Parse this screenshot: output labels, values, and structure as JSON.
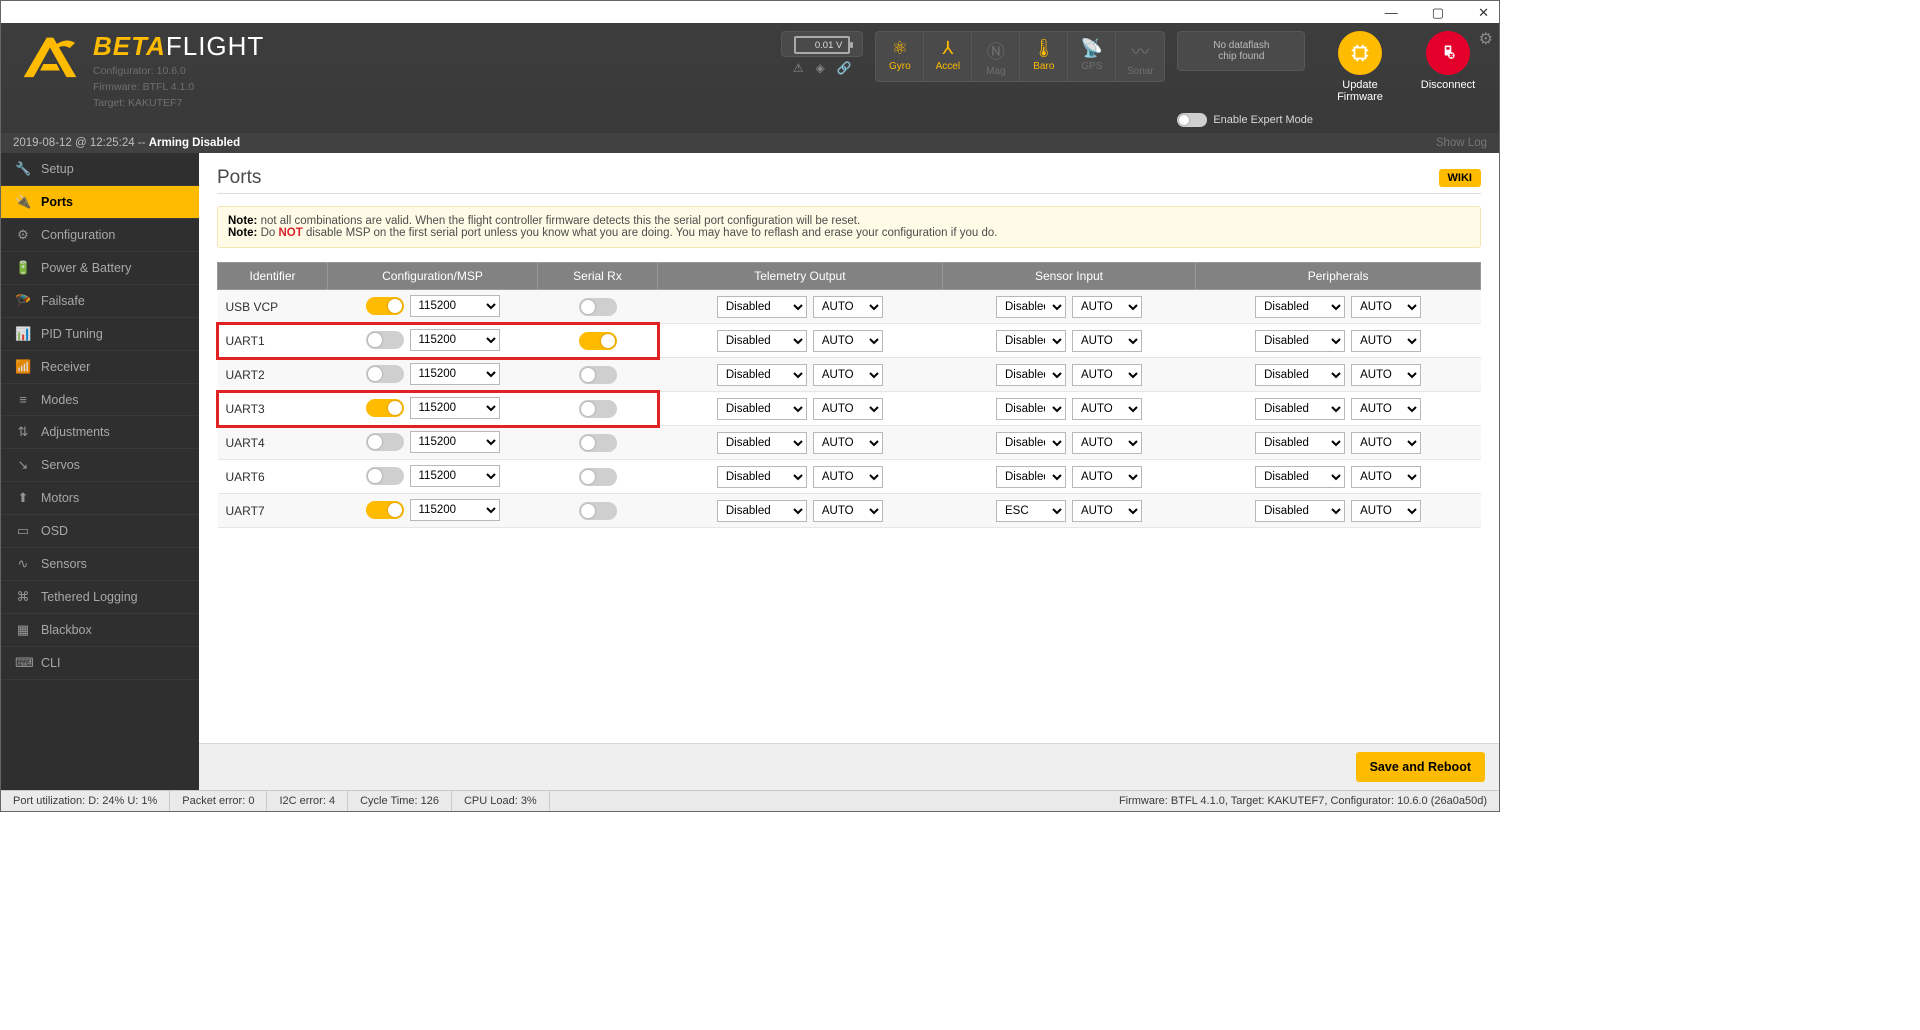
{
  "window": {
    "min": "—",
    "max": "▢",
    "close": "✕"
  },
  "header": {
    "brand_beta": "BETA",
    "brand_flight": "FLIGHT",
    "meta1": "Configurator: 10.6.0",
    "meta2": "Firmware: BTFL 4.1.0",
    "meta3": "Target: KAKUTEF7",
    "battery_v": "0.01 V",
    "sensors": [
      {
        "label": "Gyro",
        "active": true,
        "icon": "⚛"
      },
      {
        "label": "Accel",
        "active": true,
        "icon": "⅄"
      },
      {
        "label": "Mag",
        "active": false,
        "icon": "Ⓝ"
      },
      {
        "label": "Baro",
        "active": true,
        "icon": "🌡"
      },
      {
        "label": "GPS",
        "active": false,
        "icon": "📡"
      },
      {
        "label": "Sonar",
        "active": false,
        "icon": "〰"
      }
    ],
    "dataflash_l1": "No dataflash",
    "dataflash_l2": "chip found",
    "expert_label": "Enable Expert Mode",
    "update_label": "Update\nFirmware",
    "disconnect_label": "Disconnect"
  },
  "status": {
    "left": "2019-08-12 @ 12:25:24 -- ",
    "left_bold": "Arming Disabled",
    "show_log": "Show Log"
  },
  "sidebar": [
    {
      "icon": "🔧",
      "label": "Setup"
    },
    {
      "icon": "🔌",
      "label": "Ports"
    },
    {
      "icon": "⚙",
      "label": "Configuration"
    },
    {
      "icon": "🔋",
      "label": "Power & Battery"
    },
    {
      "icon": "🪂",
      "label": "Failsafe"
    },
    {
      "icon": "📊",
      "label": "PID Tuning"
    },
    {
      "icon": "📶",
      "label": "Receiver"
    },
    {
      "icon": "≡",
      "label": "Modes"
    },
    {
      "icon": "⇅",
      "label": "Adjustments"
    },
    {
      "icon": "↘",
      "label": "Servos"
    },
    {
      "icon": "⬆",
      "label": "Motors"
    },
    {
      "icon": "▭",
      "label": "OSD"
    },
    {
      "icon": "∿",
      "label": "Sensors"
    },
    {
      "icon": "⌘",
      "label": "Tethered Logging"
    },
    {
      "icon": "▦",
      "label": "Blackbox"
    },
    {
      "icon": "⌨",
      "label": "CLI"
    }
  ],
  "sidebar_active_index": 1,
  "page": {
    "title": "Ports",
    "wiki": "WIKI",
    "note_label": "Note:",
    "note1": " not all combinations are valid. When the flight controller firmware detects this the serial port configuration will be reset.",
    "note2a": " Do ",
    "note2_not": "NOT",
    "note2b": " disable MSP on the first serial port unless you know what you are doing. You may have to reflash and erase your configuration if you do.",
    "columns": [
      "Identifier",
      "Configuration/MSP",
      "Serial Rx",
      "Telemetry Output",
      "Sensor Input",
      "Peripherals"
    ],
    "rows": [
      {
        "id": "USB VCP",
        "msp_on": true,
        "msp_baud": "115200",
        "srx_on": false,
        "tel": "Disabled",
        "tel_b": "AUTO",
        "sen": "Disabled",
        "sen_b": "AUTO",
        "per": "Disabled",
        "per_b": "AUTO",
        "hl": false
      },
      {
        "id": "UART1",
        "msp_on": false,
        "msp_baud": "115200",
        "srx_on": true,
        "tel": "Disabled",
        "tel_b": "AUTO",
        "sen": "Disabled",
        "sen_b": "AUTO",
        "per": "Disabled",
        "per_b": "AUTO",
        "hl": true
      },
      {
        "id": "UART2",
        "msp_on": false,
        "msp_baud": "115200",
        "srx_on": false,
        "tel": "Disabled",
        "tel_b": "AUTO",
        "sen": "Disabled",
        "sen_b": "AUTO",
        "per": "Disabled",
        "per_b": "AUTO",
        "hl": false
      },
      {
        "id": "UART3",
        "msp_on": true,
        "msp_baud": "115200",
        "srx_on": false,
        "tel": "Disabled",
        "tel_b": "AUTO",
        "sen": "Disabled",
        "sen_b": "AUTO",
        "per": "Disabled",
        "per_b": "AUTO",
        "hl": true
      },
      {
        "id": "UART4",
        "msp_on": false,
        "msp_baud": "115200",
        "srx_on": false,
        "tel": "Disabled",
        "tel_b": "AUTO",
        "sen": "Disabled",
        "sen_b": "AUTO",
        "per": "Disabled",
        "per_b": "AUTO",
        "hl": false
      },
      {
        "id": "UART6",
        "msp_on": false,
        "msp_baud": "115200",
        "srx_on": false,
        "tel": "Disabled",
        "tel_b": "AUTO",
        "sen": "Disabled",
        "sen_b": "AUTO",
        "per": "Disabled",
        "per_b": "AUTO",
        "hl": false
      },
      {
        "id": "UART7",
        "msp_on": true,
        "msp_baud": "115200",
        "srx_on": false,
        "tel": "Disabled",
        "tel_b": "AUTO",
        "sen": "ESC",
        "sen_b": "AUTO",
        "per": "Disabled",
        "per_b": "AUTO",
        "hl": false
      }
    ],
    "save": "Save and Reboot"
  },
  "bottom": {
    "port_util": "Port utilization: D: 24% U: 1%",
    "packet_err": "Packet error: 0",
    "i2c_err": "I2C error: 4",
    "cycle": "Cycle Time: 126",
    "cpu": "CPU Load: 3%",
    "right": "Firmware: BTFL 4.1.0, Target: KAKUTEF7, Configurator: 10.6.0 (26a0a50d)"
  }
}
